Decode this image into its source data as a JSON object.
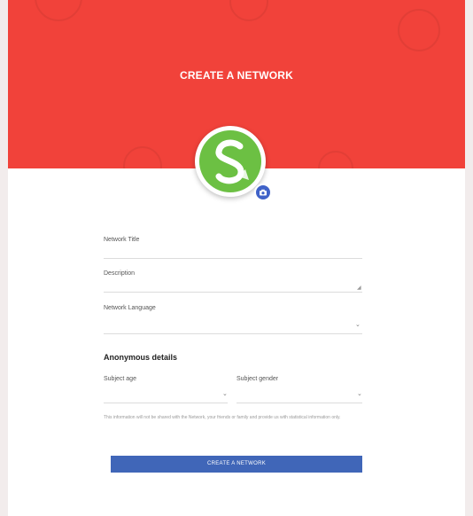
{
  "header": {
    "title": "CREATE A NETWORK",
    "background_color": "#f1423a"
  },
  "avatar": {
    "logo_icon": "s-logo-icon",
    "edit_icon": "camera-icon",
    "logo_color": "#6cc043",
    "edit_color": "#3f62c8"
  },
  "form": {
    "network_title_label": "Network Title",
    "description_label": "Description",
    "language_label": "Network Language",
    "anonymous_title": "Anonymous details",
    "age_label": "Subject age",
    "gender_label": "Subject gender",
    "note": "This information will not be shared with the Network, your friends or family and provide us with statistical information only.",
    "submit_label": "CREATE A NETWORK",
    "submit_color": "#4066b8"
  }
}
